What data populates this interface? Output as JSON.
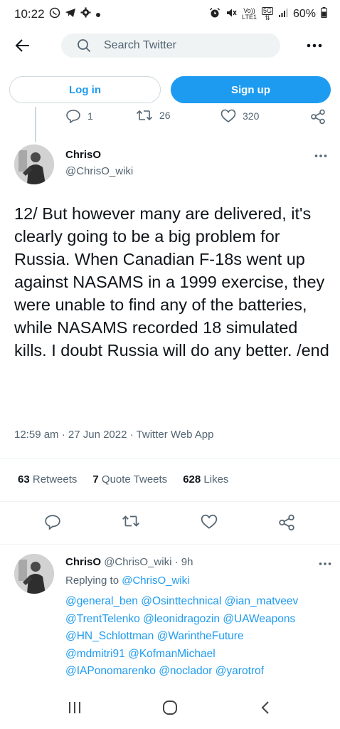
{
  "status_bar": {
    "time": "10:22",
    "battery": "60%",
    "volte_line1": "Vo))",
    "volte_line2": "LTE1",
    "net_type": "5G",
    "icons_left": [
      "whatsapp-icon",
      "telegram-icon",
      "settings-icon",
      "dot-icon"
    ],
    "icons_right": [
      "alarm-icon",
      "mute-icon",
      "signal-icon",
      "battery-icon"
    ]
  },
  "search": {
    "placeholder": "Search Twitter"
  },
  "auth": {
    "login_label": "Log in",
    "signup_label": "Sign up"
  },
  "prev_tweet_actions": {
    "replies": "1",
    "retweets": "26",
    "likes": "320"
  },
  "tweet": {
    "author_name": "ChrisO",
    "author_handle": "@ChrisO_wiki",
    "text": "12/ But however many are delivered, it's clearly going to be a big problem for Russia. When Canadian F-18s went up against NASAMS in a 1999 exercise, they were unable to find any of the batteries, while NASAMS recorded 18 simulated kills. I doubt Russia will do any better. /end",
    "time": "12:59 am",
    "date": "27 Jun 2022",
    "source": "Twitter Web App",
    "stats": {
      "retweets_count": "63",
      "retweets_label": "Retweets",
      "quotes_count": "7",
      "quotes_label": "Quote Tweets",
      "likes_count": "628",
      "likes_label": "Likes"
    }
  },
  "reply": {
    "author_name": "ChrisO",
    "author_handle": "@ChrisO_wiki",
    "age": "9h",
    "replying_prefix": "Replying to",
    "replying_to": "@ChrisO_wiki",
    "mentions_lines": [
      "@general_ben @Osinttechnical @ian_matveev",
      "@TrentTelenko @leonidragozin @UAWeapons",
      "@HN_Schlottman @WarintheFuture",
      "@mdmitri91 @KofmanMichael",
      "@IAPonomarenko @noclador @yarotrof"
    ]
  },
  "colors": {
    "accent": "#1d9bf0",
    "text": "#0f1419",
    "muted": "#536471",
    "border": "#cfd9de"
  }
}
